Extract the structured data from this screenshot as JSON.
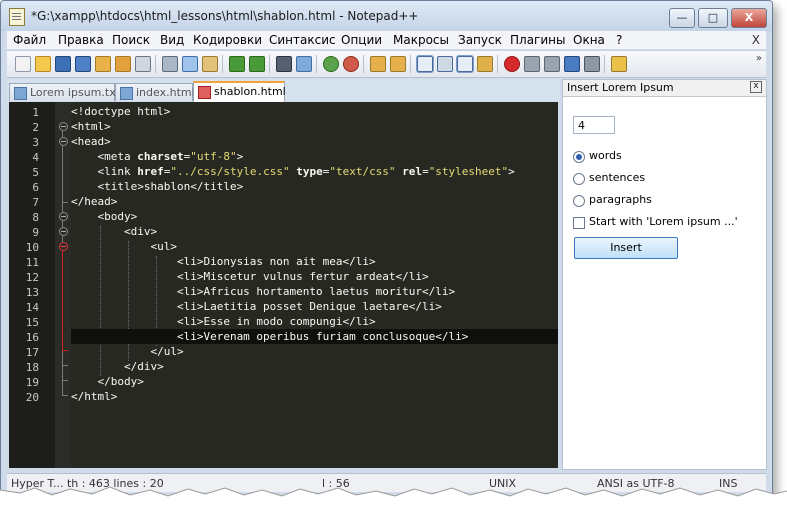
{
  "window": {
    "title": "*G:\\xampp\\htdocs\\html_lessons\\html\\shablon.html - Notepad++",
    "minimize_label": "—",
    "maximize_label": "□",
    "close_label": "X"
  },
  "menu": {
    "items": [
      "Файл",
      "Правка",
      "Поиск",
      "Вид",
      "Кодировки",
      "Синтаксис",
      "Опции",
      "Макросы",
      "Запуск",
      "Плагины",
      "Окна",
      "?"
    ],
    "close_label": "X"
  },
  "toolbar": {
    "icons": [
      "new-file-icon",
      "open-file-icon",
      "save-icon",
      "save-all-icon",
      "close-icon",
      "close-all-icon",
      "print-icon",
      "cut-icon",
      "copy-icon",
      "paste-icon",
      "undo-icon",
      "redo-icon",
      "find-icon",
      "replace-icon",
      "zoom-in-icon",
      "zoom-out-icon",
      "sync-vertical-icon",
      "sync-horizontal-icon",
      "word-wrap-icon",
      "all-characters-icon",
      "indent-guide-icon",
      "document-map-icon",
      "record-macro-icon",
      "stop-macro-icon",
      "play-macro-icon",
      "run-macro-multiple-icon",
      "save-macro-icon",
      "plugin-icon"
    ],
    "more_label": "»"
  },
  "tabs": [
    {
      "label": "Lorem ipsum.txt",
      "active": false
    },
    {
      "label": "index.html",
      "active": false
    },
    {
      "label": "shablon.html",
      "active": true
    }
  ],
  "editor": {
    "line_numbers": [
      "1",
      "2",
      "3",
      "4",
      "5",
      "6",
      "7",
      "8",
      "9",
      "10",
      "11",
      "12",
      "13",
      "14",
      "15",
      "16",
      "17",
      "18",
      "19",
      "20"
    ],
    "current_line": 16,
    "lines": [
      [
        {
          "t": "t",
          "v": "<!doctype html>"
        }
      ],
      [
        {
          "t": "t",
          "v": "<html>"
        }
      ],
      [
        {
          "t": "t",
          "v": "<head>"
        }
      ],
      [
        {
          "t": "t",
          "v": "    <meta "
        },
        {
          "t": "a",
          "v": "charset"
        },
        {
          "t": "t",
          "v": "="
        },
        {
          "t": "s",
          "v": "\"utf-8\""
        },
        {
          "t": "t",
          "v": ">"
        }
      ],
      [
        {
          "t": "t",
          "v": "    <link "
        },
        {
          "t": "a",
          "v": "href"
        },
        {
          "t": "t",
          "v": "="
        },
        {
          "t": "s",
          "v": "\"../css/style.css\""
        },
        {
          "t": "t",
          "v": " "
        },
        {
          "t": "a",
          "v": "type"
        },
        {
          "t": "t",
          "v": "="
        },
        {
          "t": "s",
          "v": "\"text/css\""
        },
        {
          "t": "t",
          "v": " "
        },
        {
          "t": "a",
          "v": "rel"
        },
        {
          "t": "t",
          "v": "="
        },
        {
          "t": "s",
          "v": "\"stylesheet\""
        },
        {
          "t": "t",
          "v": ">"
        }
      ],
      [
        {
          "t": "t",
          "v": "    <title>shablon</title>"
        }
      ],
      [
        {
          "t": "t",
          "v": "</head>"
        }
      ],
      [
        {
          "t": "t",
          "v": "    <body>"
        }
      ],
      [
        {
          "t": "t",
          "v": "        <div>"
        }
      ],
      [
        {
          "t": "t",
          "v": "            <ul>"
        }
      ],
      [
        {
          "t": "t",
          "v": "                <li>Dionysias non ait mea</li>"
        }
      ],
      [
        {
          "t": "t",
          "v": "                <li>Miscetur vulnus fertur ardeat</li>"
        }
      ],
      [
        {
          "t": "t",
          "v": "                <li>Africus hortamento laetus moritur</li>"
        }
      ],
      [
        {
          "t": "t",
          "v": "                <li>Laetitia posset Denique laetare</li>"
        }
      ],
      [
        {
          "t": "t",
          "v": "                <li>Esse in modo compungi</li>"
        }
      ],
      [
        {
          "t": "t",
          "v": "                <li>Verenam operibus furiam conclusoque</li>"
        }
      ],
      [
        {
          "t": "t",
          "v": "            </ul>"
        }
      ],
      [
        {
          "t": "t",
          "v": "        </div>"
        }
      ],
      [
        {
          "t": "t",
          "v": "    </body>"
        }
      ],
      [
        {
          "t": "t",
          "v": "</html>"
        }
      ]
    ],
    "colors": {
      "background": "#272822",
      "text": "#f8f8f2",
      "string": "#e6db74",
      "current_line": "#0f0f0d"
    }
  },
  "panel": {
    "title": "Insert Lorem Ipsum",
    "close_label": "x",
    "count_value": "4",
    "options": [
      {
        "label": "words",
        "selected": true
      },
      {
        "label": "sentences",
        "selected": false
      },
      {
        "label": "paragraphs",
        "selected": false
      }
    ],
    "start_with_label": "Start with 'Lorem ipsum ...'",
    "start_with_checked": false,
    "insert_label": "Insert"
  },
  "status": {
    "left": "Hyper T... th : 463 lines : 20",
    "pos": "l : 56",
    "eol": "UNIX",
    "encoding": "ANSI as UTF-8",
    "mode": "INS"
  }
}
